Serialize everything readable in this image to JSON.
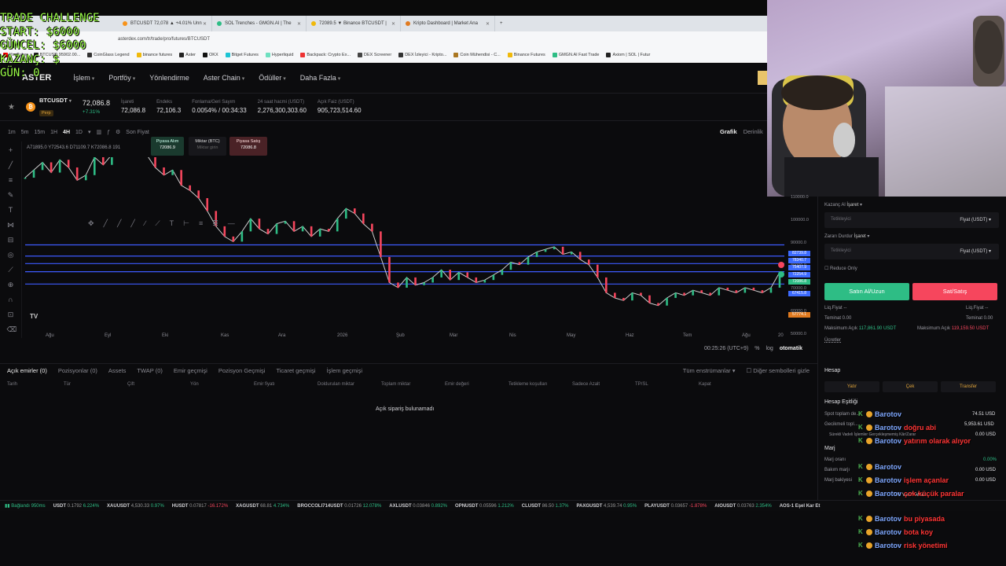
{
  "overlay": {
    "line1": "TRADE CHALLENGE",
    "line2": "START: $6000",
    "line3": "GÜNCEL: $6000",
    "line4": "KAZANÇ: $",
    "line5": "GÜN: 0"
  },
  "browser": {
    "tabs": [
      {
        "label": "BTCUSDT 72,078 ▲ +4.01% Unn",
        "color": "#f7931a"
      },
      {
        "label": "SOL Trenches - GMGN.AI | The",
        "color": "#2ebd85"
      },
      {
        "label": "72089.5 ▼ Binance BTCUSDT |",
        "color": "#f0b90b"
      },
      {
        "label": "Kripto Dashboard | Market Ana",
        "color": "#e07a1f"
      }
    ],
    "address": "asterdex.com/tr/trade/pro/futures/BTCUSDT",
    "bookmarks": [
      {
        "label": "YouTube",
        "color": "#ff0000"
      },
      {
        "label": "BTCUSD 95902.00...",
        "color": "#222222"
      },
      {
        "label": "CoinGlass Legend",
        "color": "#333333"
      },
      {
        "label": "binance futures",
        "color": "#f0b90b"
      },
      {
        "label": "Aster",
        "color": "#222222"
      },
      {
        "label": "OKX",
        "color": "#111111"
      },
      {
        "label": "Bitget Futures",
        "color": "#1dc4d4"
      },
      {
        "label": "Hyperliquid",
        "color": "#6ee0c0"
      },
      {
        "label": "Backpack: Crypto Ex...",
        "color": "#e33"
      },
      {
        "label": "DEX Screener",
        "color": "#444444"
      },
      {
        "label": "DEX İzleyici - Kripto...",
        "color": "#333333"
      },
      {
        "label": "Coin Mühendisi - C...",
        "color": "#aa7722"
      },
      {
        "label": "Binance Futures",
        "color": "#f0b90b"
      },
      {
        "label": "GMGN.AI Fast Trade",
        "color": "#2ebd85"
      },
      {
        "label": "Axiom | SOL | Futur",
        "color": "#222222"
      }
    ]
  },
  "nav": {
    "logo": "ASTER",
    "items": [
      "İşlem",
      "Portföy",
      "Yönlendirme",
      "Aster Chain",
      "Ödüller",
      "Daha Fazla"
    ]
  },
  "ticker": {
    "symbol": "BTCUSDT",
    "tag": "Perp",
    "price": "72,086.8",
    "change": "+7.31%",
    "stats": [
      {
        "label": "İşareti",
        "value": "72,086.8"
      },
      {
        "label": "Endeks",
        "value": "72,106.3"
      },
      {
        "label": "Fonlama/Geri Sayım",
        "value": "0.0054% / 00:34:33"
      },
      {
        "label": "24 saat hacmi (USDT)",
        "value": "2,276,300,303.60"
      },
      {
        "label": "Açık Faiz (USDT)",
        "value": "905,723,514.60"
      }
    ]
  },
  "chart_tools": {
    "intervals": [
      "1m",
      "5m",
      "15m",
      "1H",
      "4H",
      "1D"
    ],
    "active_interval": "4H",
    "last_price_label": "Son Fiyat",
    "tabs": [
      "Grafik",
      "Derinlik"
    ],
    "ohlc": "A71895.0  Y72543.6  D71109.7  K72086.8  191",
    "order_boxes": [
      {
        "label": "Piyasa Alım",
        "value": "72086.9"
      },
      {
        "label": "Miktar (BTC)",
        "value": "Miktar girin"
      },
      {
        "label": "Piyasa Satış",
        "value": "72086.8"
      }
    ]
  },
  "chart_data": {
    "type": "line",
    "x_labels": [
      "Ağu",
      "Eyl",
      "Eki",
      "Kas",
      "Ara",
      "2026",
      "Şub",
      "Mar",
      "Nis",
      "May",
      "Haz",
      "Tem",
      "Ağu",
      "20"
    ],
    "y_ticks": [
      "110000.0",
      "100000.0",
      "90000.0",
      "80000.0",
      "70000.0",
      "60000.0",
      "50000.0"
    ],
    "price_labels": [
      {
        "value": "82739.8",
        "color": "#3d6bff"
      },
      {
        "value": "78340.7",
        "color": "#3d6bff"
      },
      {
        "value": "75407.9",
        "color": "#3d6bff"
      },
      {
        "value": "72254.9",
        "color": "#3d6bff"
      },
      {
        "value": "72086.8",
        "color": "#2ebd85"
      },
      {
        "value": "67415.8",
        "color": "#3d6bff"
      },
      {
        "value": "57774.1",
        "color": "#e07a1f"
      }
    ],
    "y_range": [
      50000,
      117000
    ],
    "horizontal_levels": [
      82739.8,
      78340.7,
      75407.9,
      72254.9,
      67415.8
    ],
    "series": [
      {
        "values": [
          109000,
          112000,
          115000,
          111000,
          116000,
          113000,
          108000,
          110000,
          117000,
          114000,
          118000,
          121000,
          122000,
          124000,
          118000,
          113000,
          110000,
          112000,
          106000,
          104000,
          101000,
          96000,
          90000,
          86000,
          84000,
          88000,
          93000,
          89000,
          87000,
          91000,
          92000,
          88000,
          90000,
          86000,
          89000,
          88000,
          93000,
          97000,
          95000,
          91000,
          88000,
          78000,
          68000,
          66000,
          70000,
          67000,
          68000,
          70000,
          73000,
          69000,
          72000,
          70000,
          68000,
          69000,
          71000,
          73000,
          76000,
          75000,
          78000,
          80000,
          81000,
          82000,
          79000,
          80000,
          77000,
          75000,
          70000,
          64000,
          62000,
          61000,
          64000,
          63000,
          60000,
          59000,
          62000,
          64000,
          63000,
          65000,
          64000,
          63000,
          66000,
          65000,
          64000,
          66000,
          65000,
          64000,
          66000,
          72000
        ]
      }
    ]
  },
  "draw_toolbar": [
    "✥",
    "╱",
    "╱",
    "╱",
    "∕",
    "⟋",
    "T",
    "⊢",
    "≡",
    "≣",
    "—"
  ],
  "time_bar": {
    "clock": "00:25:26 (UTC+9)",
    "percent": "%",
    "log": "log",
    "auto": "otomatik"
  },
  "order_tabs": [
    "Açık emirler (0)",
    "Pozisyonlar (0)",
    "Assets",
    "TWAP (0)",
    "Emir geçmişi",
    "Pozisyon Geçmişi",
    "Ticaret geçmişi",
    "İşlem geçmişi"
  ],
  "order_filters": {
    "instruments": "Tüm enstrümanlar",
    "hide_other": "Diğer sembolleri gizle"
  },
  "order_headers": [
    "Tarih",
    "Tür",
    "Çift",
    "Yön",
    "Emir fiyatı",
    "Doldurulan miktar",
    "Toplam miktar",
    "Emir değeri",
    "Tetikleme koşulları",
    "Sadece Azalt",
    "TP/SL",
    "Kapat"
  ],
  "empty_text": "Açık sipariş bulunamadı",
  "bottom_ticker": {
    "status": "Bağlandı 950ms",
    "items": [
      {
        "sym": "USDT",
        "price": "0.1792",
        "chg": "6.224%",
        "up": true
      },
      {
        "sym": "XAUUSDT",
        "price": "4,530.33",
        "chg": "0.97%",
        "up": true
      },
      {
        "sym": "HUSDT",
        "price": "0.07817",
        "chg": "-16.172%",
        "up": false
      },
      {
        "sym": "XAGUSDT",
        "price": "68.81",
        "chg": "4.734%",
        "up": true
      },
      {
        "sym": "BROCCOLI714USDT",
        "price": "0.01726",
        "chg": "12.078%",
        "up": true
      },
      {
        "sym": "AXLUSDT",
        "price": "0.03846",
        "chg": "0.892%",
        "up": true
      },
      {
        "sym": "OPNUSDT",
        "price": "0.05596",
        "chg": "1.212%",
        "up": true
      },
      {
        "sym": "CLUSDT",
        "price": "86.50",
        "chg": "1.37%",
        "up": true
      },
      {
        "sym": "PAXGUSDT",
        "price": "4,539.74",
        "chg": "0.95%",
        "up": true
      },
      {
        "sym": "PLAYUSDT",
        "price": "0.03657",
        "chg": "-1.878%",
        "up": false
      },
      {
        "sym": "AIOUSDT",
        "price": "0.03763",
        "chg": "2.354%",
        "up": true
      },
      {
        "sym": "AOS-1 Eşel Kar Et",
        "price": "",
        "chg": "",
        "up": true
      }
    ]
  },
  "right_panel": {
    "take_profit": "Kazanç Al",
    "stop_loss": "Zararı Durdur",
    "mark": "İşaret",
    "trigger_placeholder": "Tetikleyici",
    "price_unit": "Fiyat (USDT)",
    "reduce_only": "Reduce Only",
    "buy": "Satın Al/Uzun",
    "sell": "Sat/Satış",
    "liq_left": "Liq.Fiyat --",
    "liq_right": "Liq.Fiyat --",
    "margin_left": "Teminat 0.00",
    "margin_right": "Teminat 0.00",
    "max_left_label": "Maksimum Açık",
    "max_left": "117,861.90 USDT",
    "max_right_label": "Maksimum Açık",
    "max_right": "119,159.50 USDT",
    "fees": "Ücretler",
    "account_title": "Hesap",
    "deposit": "Yatır",
    "withdraw": "Çek",
    "transfer": "Transfer",
    "equity_title": "Hesap Eşitliği",
    "spot_label": "Spot toplam de...",
    "spot_value": "74.51 USD",
    "futures_label": "Gecikmeli topl...",
    "futures_value": "5,953.61 USD",
    "unreal_label": "Sürekli Vadeli İşlemler Gerçekleşmemiş Kâr/Zarar",
    "unreal_value": "0.00 USD",
    "margin_title": "Marj",
    "margin_ratio": "Marj oranı",
    "margin_ratio_value": "0.00%",
    "maint_label": "Bakım marjı",
    "maint_value": "0.00 USD",
    "balance_label": "Marj bakiyesi",
    "balance_value": "0.00 USD",
    "multi_asset": "Tek Varlık Modu"
  },
  "chat": [
    {
      "name": "Barotov",
      "msg": "",
      "top": 0
    },
    {
      "name": "Barotov",
      "msg": "doğru abi",
      "top": 17
    },
    {
      "name": "Barotov",
      "msg": "yatırım olarak alıyor",
      "top": 34
    },
    {
      "name": "Barotov",
      "msg": "",
      "top": 67
    },
    {
      "name": "Barotov",
      "msg": "işlem açanlar",
      "top": 84
    },
    {
      "name": "Barotov",
      "msg": "çok küçük paralar",
      "top": 101
    },
    {
      "name": "Barotov",
      "msg": "bu piyasada",
      "top": 133
    },
    {
      "name": "Barotov",
      "msg": "bota koy",
      "top": 150
    },
    {
      "name": "Barotov",
      "msg": "risk yönetimi",
      "top": 167
    }
  ]
}
